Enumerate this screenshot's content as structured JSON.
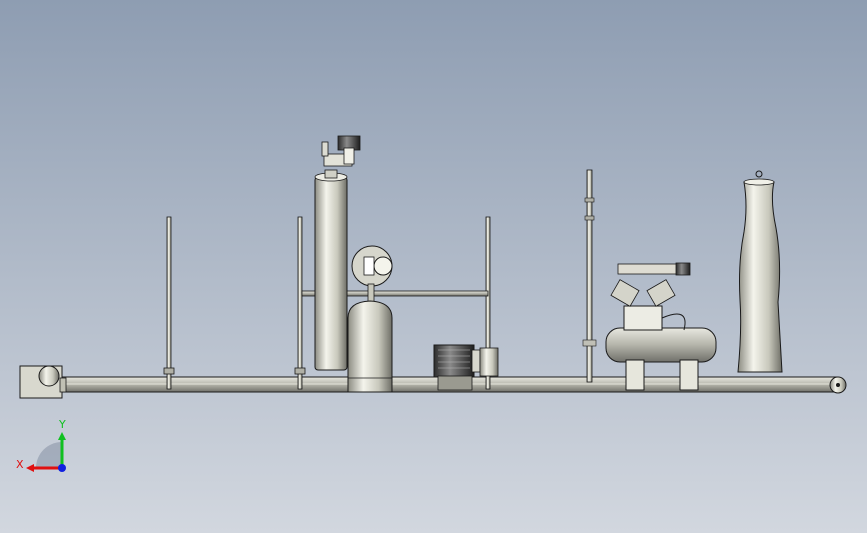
{
  "triad": {
    "x_label": "X",
    "y_label": "Y",
    "x_color": "#e01010",
    "y_color": "#10c020",
    "z_color": "#1020e0"
  },
  "colors": {
    "background_top": "#8e9db2",
    "background_bottom": "#d2d7df",
    "metal_light": "#f2f2ea",
    "metal_dark": "#7a7a70",
    "outline": "#1a1a1a"
  },
  "components": [
    "base-rail",
    "motor-housing-left",
    "support-post",
    "tall-cylinder-tank",
    "valve-assembly",
    "pressure-gauge",
    "gas-bottle",
    "electric-motor",
    "control-mast",
    "air-compressor",
    "tapered-silo",
    "end-pulley"
  ]
}
